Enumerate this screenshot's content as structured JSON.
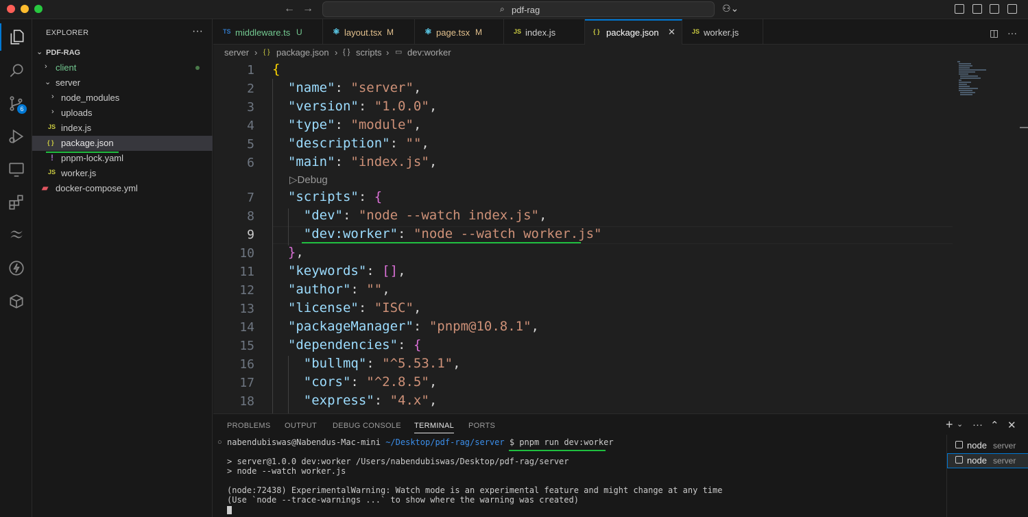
{
  "titlebar": {
    "search_text": "pdf-rag"
  },
  "activity": {
    "scm_badge": "6"
  },
  "explorer": {
    "title": "EXPLORER",
    "more": "···",
    "root": "PDF-RAG",
    "items": [
      {
        "label": "client",
        "type": "folder",
        "expanded": false,
        "modified": true
      },
      {
        "label": "server",
        "type": "folder",
        "expanded": true
      },
      {
        "label": "node_modules",
        "type": "folder",
        "expanded": false
      },
      {
        "label": "uploads",
        "type": "folder",
        "expanded": false
      },
      {
        "label": "index.js",
        "type": "file",
        "icon": "JS"
      },
      {
        "label": "package.json",
        "type": "file",
        "icon": "{ }",
        "selected": true
      },
      {
        "label": "pnpm-lock.yaml",
        "type": "file",
        "icon": "!"
      },
      {
        "label": "worker.js",
        "type": "file",
        "icon": "JS"
      },
      {
        "label": "docker-compose.yml",
        "type": "file",
        "icon": "docker-icon"
      }
    ]
  },
  "tabs": [
    {
      "icon": "TS",
      "label": "middleware.ts",
      "status": "U"
    },
    {
      "icon": "⚛",
      "label": "layout.tsx",
      "status": "M"
    },
    {
      "icon": "⚛",
      "label": "page.tsx",
      "status": "M"
    },
    {
      "icon": "JS",
      "label": "index.js",
      "status": ""
    },
    {
      "icon": "{ }",
      "label": "package.json",
      "status": "",
      "active": true
    },
    {
      "icon": "JS",
      "label": "worker.js",
      "status": ""
    }
  ],
  "breadcrumb": [
    "server",
    "package.json",
    "scripts",
    "dev:worker"
  ],
  "editor": {
    "line_numbers": [
      "1",
      "2",
      "3",
      "4",
      "5",
      "6",
      "7",
      "8",
      "9",
      "10",
      "11",
      "12",
      "13",
      "14",
      "15",
      "16",
      "17",
      "18"
    ],
    "codelens": "Debug",
    "lines": {
      "l1_brace": "{",
      "l2_key": "\"name\"",
      "l2_val": "\"server\"",
      "l3_key": "\"version\"",
      "l3_val": "\"1.0.0\"",
      "l4_key": "\"type\"",
      "l4_val": "\"module\"",
      "l5_key": "\"description\"",
      "l5_val": "\"\"",
      "l6_key": "\"main\"",
      "l6_val": "\"index.js\"",
      "l7_key": "\"scripts\"",
      "l7_brace": "{",
      "l8_key": "\"dev\"",
      "l8_val": "\"node --watch index.js\"",
      "l9_key": "\"dev:worker\"",
      "l9_val": "\"node --watch worker.js\"",
      "l10_brace": "}",
      "l11_key": "\"keywords\"",
      "l11_val": "[]",
      "l12_key": "\"author\"",
      "l12_val": "\"\"",
      "l13_key": "\"license\"",
      "l13_val": "\"ISC\"",
      "l14_key": "\"packageManager\"",
      "l14_val": "\"pnpm@10.8.1\"",
      "l15_key": "\"dependencies\"",
      "l15_brace": "{",
      "l16_key": "\"bullmq\"",
      "l16_val": "\"^5.53.1\"",
      "l17_key": "\"cors\"",
      "l17_val": "\"^2.8.5\"",
      "l18_key": "\"express\"",
      "l18_val": "\"4.x\""
    }
  },
  "panel": {
    "tabs": [
      "PROBLEMS",
      "OUTPUT",
      "DEBUG CONSOLE",
      "TERMINAL",
      "PORTS"
    ],
    "active_tab": "TERMINAL",
    "terminal": {
      "prompt_user": "nabendubiswas@Nabendus-Mac-mini",
      "prompt_path": "~/Desktop/pdf-rag/server",
      "prompt_symbol": "$",
      "command": "pnpm run dev:worker",
      "output": [
        "> server@1.0.0 dev:worker /Users/nabendubiswas/Desktop/pdf-rag/server",
        "> node --watch worker.js",
        "(node:72438) ExperimentalWarning: Watch mode is an experimental feature and might change at any time",
        "(Use `node --trace-warnings ...` to show where the warning was created)"
      ]
    },
    "terminal_list": [
      {
        "name": "node",
        "sub": "server"
      },
      {
        "name": "node",
        "sub": "server",
        "active": true
      }
    ]
  }
}
